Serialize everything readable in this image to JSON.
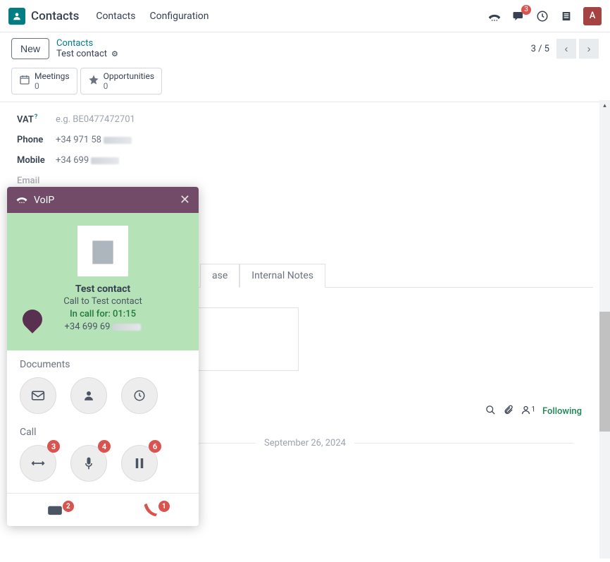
{
  "navbar": {
    "brand": "Contacts",
    "menu": [
      "Contacts",
      "Configuration"
    ],
    "messagesBadge": "3",
    "avatarLetter": "A"
  },
  "control": {
    "newLabel": "New",
    "breadcrumbParent": "Contacts",
    "breadcrumbCurrent": "Test contact",
    "pager": "3 / 5"
  },
  "stats": {
    "meetings": {
      "label": "Meetings",
      "count": "0"
    },
    "opportunities": {
      "label": "Opportunities",
      "count": "0"
    }
  },
  "form": {
    "vatLabel": "VAT",
    "vatPlaceholder": "e.g. BE0477472701",
    "phoneLabel": "Phone",
    "phoneValuePrefix": "+34 971 58 ",
    "mobileLabel": "Mobile",
    "mobileValuePrefix": "+34 699 ",
    "emailLabel": "Email",
    "tabs": {
      "partial": "ase",
      "internalNotes": "Internal Notes"
    }
  },
  "chatter": {
    "followerCount": "1",
    "followingLabel": "Following",
    "dateDivider": "September 26, 2024"
  },
  "voip": {
    "title": "VoIP",
    "contactName": "Test contact",
    "subLine": "Call to Test contact",
    "statusPrefix": "In call for: ",
    "duration": "01:15",
    "numberPrefix": "+34 699 69",
    "documentsLabel": "Documents",
    "callLabel": "Call",
    "badges": {
      "transfer": "3",
      "mute": "4",
      "pause": "6",
      "keypad": "2",
      "hangup": "1"
    }
  }
}
